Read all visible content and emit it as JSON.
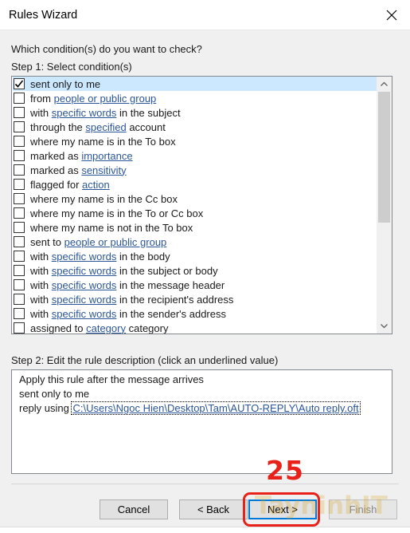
{
  "window": {
    "title": "Rules Wizard"
  },
  "question": "Which condition(s) do you want to check?",
  "step1_label": "Step 1: Select condition(s)",
  "conditions": [
    {
      "checked": true,
      "selected": true,
      "before": "sent only to me",
      "link": "",
      "after": ""
    },
    {
      "checked": false,
      "selected": false,
      "before": "from ",
      "link": "people or public group",
      "after": ""
    },
    {
      "checked": false,
      "selected": false,
      "before": "with ",
      "link": "specific words",
      "after": " in the subject"
    },
    {
      "checked": false,
      "selected": false,
      "before": "through the ",
      "link": "specified",
      "after": " account"
    },
    {
      "checked": false,
      "selected": false,
      "before": "where my name is in the To box",
      "link": "",
      "after": ""
    },
    {
      "checked": false,
      "selected": false,
      "before": "marked as ",
      "link": "importance",
      "after": ""
    },
    {
      "checked": false,
      "selected": false,
      "before": "marked as ",
      "link": "sensitivity",
      "after": ""
    },
    {
      "checked": false,
      "selected": false,
      "before": "flagged for ",
      "link": "action",
      "after": ""
    },
    {
      "checked": false,
      "selected": false,
      "before": "where my name is in the Cc box",
      "link": "",
      "after": ""
    },
    {
      "checked": false,
      "selected": false,
      "before": "where my name is in the To or Cc box",
      "link": "",
      "after": ""
    },
    {
      "checked": false,
      "selected": false,
      "before": "where my name is not in the To box",
      "link": "",
      "after": ""
    },
    {
      "checked": false,
      "selected": false,
      "before": "sent to ",
      "link": "people or public group",
      "after": ""
    },
    {
      "checked": false,
      "selected": false,
      "before": "with ",
      "link": "specific words",
      "after": " in the body"
    },
    {
      "checked": false,
      "selected": false,
      "before": "with ",
      "link": "specific words",
      "after": " in the subject or body"
    },
    {
      "checked": false,
      "selected": false,
      "before": "with ",
      "link": "specific words",
      "after": " in the message header"
    },
    {
      "checked": false,
      "selected": false,
      "before": "with ",
      "link": "specific words",
      "after": " in the recipient's address"
    },
    {
      "checked": false,
      "selected": false,
      "before": "with ",
      "link": "specific words",
      "after": " in the sender's address"
    },
    {
      "checked": false,
      "selected": false,
      "before": "assigned to ",
      "link": "category",
      "after": " category"
    }
  ],
  "step2_label": "Step 2: Edit the rule description (click an underlined value)",
  "description": {
    "line1": "Apply this rule after the message arrives",
    "line2": "sent only to me",
    "line3_prefix": "reply using ",
    "line3_path": "C:\\Users\\Ngoc Hien\\Desktop\\Tam\\AUTO-REPLY\\Auto reply.oft"
  },
  "buttons": {
    "cancel": "Cancel",
    "back": "< Back",
    "next": "Next >",
    "finish": "Finish"
  },
  "annotation": {
    "step_number": "25",
    "watermark": "TayninhIT"
  },
  "colors": {
    "link": "#2b579a",
    "selection": "#cce8ff",
    "annotation": "#e8211a"
  },
  "icons": {
    "close": "close-icon",
    "scroll_up": "chevron-up-icon",
    "scroll_down": "chevron-down-icon",
    "check": "checkmark-icon"
  }
}
